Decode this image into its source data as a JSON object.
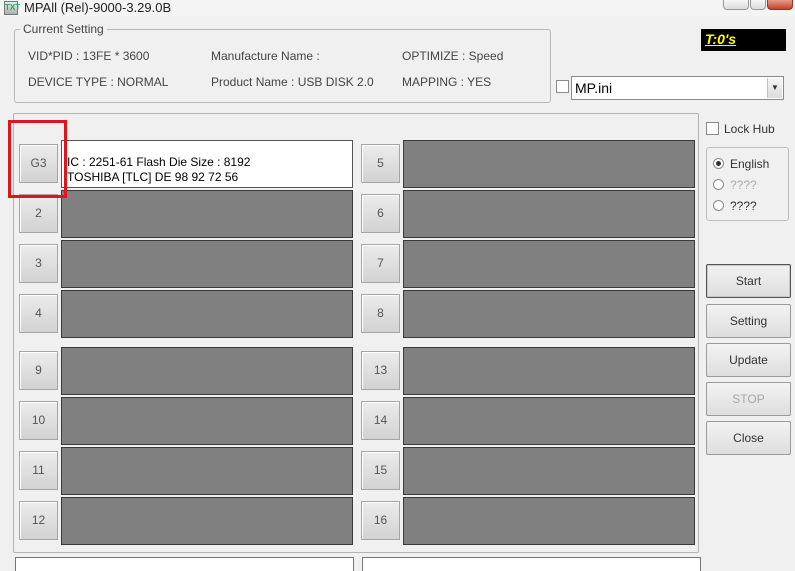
{
  "window": {
    "title": "MPAll (Rel)-9000-3.29.0B",
    "icon_label": "TXT"
  },
  "current_setting": {
    "legend": "Current Setting",
    "vid_pid": "VID*PID : 13FE * 3600",
    "device_type": "DEVICE TYPE : NORMAL",
    "manufacture_name": "Manufacture Name :",
    "product_name": "Product Name : USB DISK 2.0",
    "optimize": "OPTIMIZE : Speed",
    "mapping": "MAPPING : YES"
  },
  "timer": "T:0's",
  "ini_select": {
    "value": "MP.ini",
    "checked": false
  },
  "ports": [
    {
      "label": "G3",
      "active": true,
      "lines": [
        "IC : 2251-61  Flash Die Size : 8192",
        "TOSHIBA [TLC] DE 98 92 72 56"
      ]
    },
    {
      "label": "2"
    },
    {
      "label": "3"
    },
    {
      "label": "4"
    },
    {
      "label": "5"
    },
    {
      "label": "6"
    },
    {
      "label": "7"
    },
    {
      "label": "8"
    },
    {
      "label": "9"
    },
    {
      "label": "10"
    },
    {
      "label": "11"
    },
    {
      "label": "12"
    },
    {
      "label": "13"
    },
    {
      "label": "14"
    },
    {
      "label": "15"
    },
    {
      "label": "16"
    }
  ],
  "sidebar": {
    "lock_hub": "Lock Hub",
    "languages": [
      {
        "label": "English",
        "selected": true
      },
      {
        "label": "????",
        "selected": false
      },
      {
        "label": "????",
        "selected": false
      }
    ],
    "buttons": {
      "start": "Start",
      "setting": "Setting",
      "update": "Update",
      "stop": "STOP",
      "close": "Close"
    }
  },
  "colors": {
    "slot_empty": "#808080",
    "timer_text": "#ffff00",
    "highlight": "#e0141c"
  }
}
